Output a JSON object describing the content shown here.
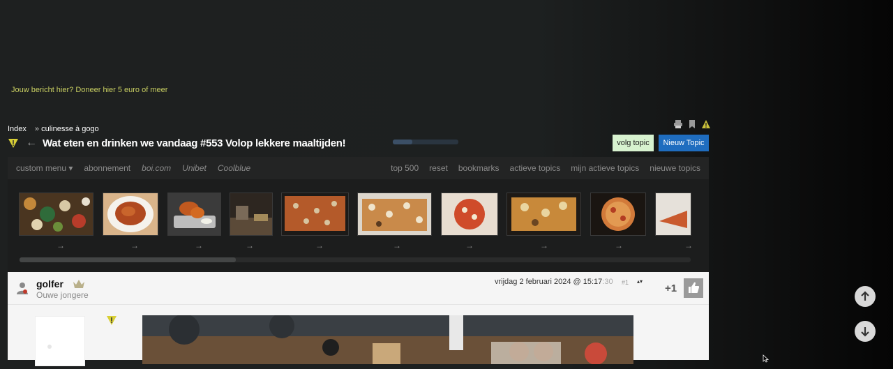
{
  "promo": {
    "text": "Jouw bericht hier? Doneer hier 5 euro of meer"
  },
  "breadcrumb": {
    "root": "Index",
    "separator": "»",
    "section": "culinesse à gogo"
  },
  "top_icons": [
    "print-icon",
    "bookmark-icon",
    "warning-icon"
  ],
  "topic": {
    "title": "Wat eten en drinken we vandaag #553 Volop lekkere maaltijden!",
    "follow_label": "volg topic",
    "new_topic_label": "Nieuw Topic",
    "progress": 0.3
  },
  "menu": {
    "left": [
      {
        "label": "custom menu",
        "italic": false,
        "dropdown": true
      },
      {
        "label": "abonnement",
        "italic": false
      },
      {
        "label": "boi.com",
        "italic": true
      },
      {
        "label": "Unibet",
        "italic": true
      },
      {
        "label": "Coolblue",
        "italic": true
      }
    ],
    "dropdown_icon": "▾",
    "right": [
      "top 500",
      "reset",
      "bookmarks",
      "actieve topics",
      "mijn actieve topics",
      "nieuwe topics"
    ]
  },
  "thumbnails": {
    "arrow": "→",
    "items": [
      {
        "name": "thumb-food-table"
      },
      {
        "name": "thumb-pasta-plate"
      },
      {
        "name": "thumb-chicken-wings"
      },
      {
        "name": "thumb-kitchen-counter"
      },
      {
        "name": "thumb-sheet-pizza"
      },
      {
        "name": "thumb-sheet-pizza-2"
      },
      {
        "name": "thumb-round-pizza"
      },
      {
        "name": "thumb-focaccia"
      },
      {
        "name": "thumb-pizza-closeup"
      },
      {
        "name": "thumb-pizza-slice"
      }
    ],
    "scroll_position": 0.0
  },
  "post": {
    "username": "golfer",
    "user_title": "Ouwe jongere",
    "date": "vrijdag 2 februari 2024 @ 15:17",
    "seconds": ":30",
    "post_number": "#1",
    "nav_arrows": "▴▾",
    "plus_one": "+1"
  },
  "colors": {
    "promo": "#c9cf62",
    "follow_button": "#d7f2cf",
    "new_topic_button": "#1f6dbf",
    "menubar": "#232424",
    "post_background": "#f5f5f5"
  },
  "scroll_buttons": [
    "scroll-up-icon",
    "scroll-down-icon"
  ]
}
